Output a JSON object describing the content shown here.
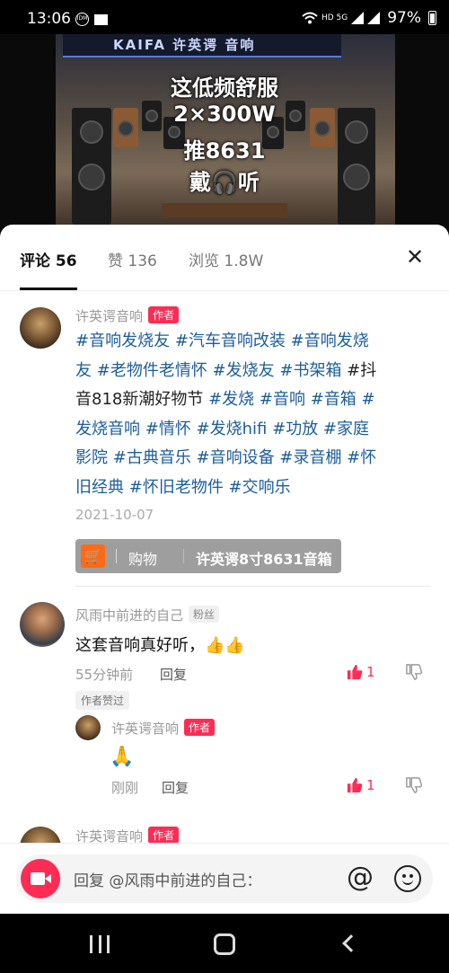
{
  "status_bar": {
    "time": "13:06",
    "battery": "97%",
    "network": "HD 5G"
  },
  "video": {
    "sign_text": "KAIFA 许英谔 音响",
    "caption_lines": [
      "这低频舒服",
      "2×300W",
      "推8631",
      "戴🎧听"
    ]
  },
  "tabs": [
    {
      "label": "评论 56",
      "active": true
    },
    {
      "label": "赞 136",
      "active": false
    },
    {
      "label": "浏览 1.8W",
      "active": false
    }
  ],
  "close_icon": "close-icon",
  "author_post": {
    "username": "许英谔音响",
    "badge": "作者",
    "segments": [
      {
        "text": "#音响发烧友 ",
        "tag": true
      },
      {
        "text": "#汽车音响改装 ",
        "tag": true
      },
      {
        "text": "#音响发烧友 ",
        "tag": true
      },
      {
        "text": "#老物件老情怀 ",
        "tag": true
      },
      {
        "text": "#发烧友 ",
        "tag": true
      },
      {
        "text": "#书架箱 ",
        "tag": true
      },
      {
        "text": "#抖音818新潮好物节 ",
        "tag": false
      },
      {
        "text": "#发烧 ",
        "tag": true
      },
      {
        "text": "#音响 ",
        "tag": true
      },
      {
        "text": "#音箱 ",
        "tag": true
      },
      {
        "text": "#发烧音响 ",
        "tag": true
      },
      {
        "text": "#情怀 ",
        "tag": true
      },
      {
        "text": "#发烧hifi ",
        "tag": true
      },
      {
        "text": "#功放 ",
        "tag": true
      },
      {
        "text": "#家庭影院 ",
        "tag": true
      },
      {
        "text": "#古典音乐 ",
        "tag": true
      },
      {
        "text": "#音响设备 ",
        "tag": true
      },
      {
        "text": "#录音棚 ",
        "tag": true
      },
      {
        "text": "#怀旧经典 ",
        "tag": true
      },
      {
        "text": "#怀旧老物件 ",
        "tag": true
      },
      {
        "text": "#交响乐",
        "tag": true
      }
    ],
    "date": "2021-10-07",
    "shop": {
      "label": "购物",
      "product": "许英谔8寸8631音箱"
    }
  },
  "comment": {
    "username": "风雨中前进的自己",
    "badge": "粉丝",
    "text": "这套音响真好听，👍👍",
    "time": "55分钟前",
    "reply_label": "回复",
    "likes": "1",
    "liked_by_author": "作者赞过"
  },
  "reply": {
    "username": "许英谔音响",
    "badge": "作者",
    "text": "🙏",
    "time": "刚刚",
    "reply_label": "回复",
    "likes": "1"
  },
  "next_comment": {
    "username": "许英谔音响",
    "badge": "作者"
  },
  "input": {
    "placeholder": "回复 @风雨中前进的自己："
  },
  "colors": {
    "accent": "#fe2c55",
    "tag": "#1c5d9b",
    "shop_icon": "#fe6b14"
  }
}
